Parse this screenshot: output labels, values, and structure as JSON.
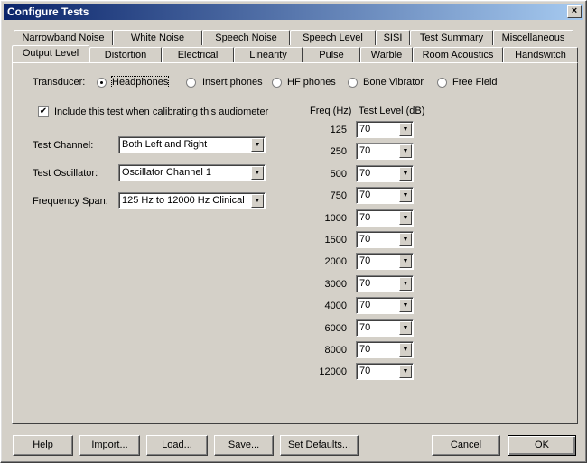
{
  "window": {
    "title": "Configure Tests",
    "close": "×"
  },
  "tabs_back": [
    "Narrowband Noise",
    "White Noise",
    "Speech Noise",
    "Speech Level",
    "SISI",
    "Test Summary",
    "Miscellaneous"
  ],
  "tabs_front": [
    "Output Level",
    "Distortion",
    "Electrical",
    "Linearity",
    "Pulse",
    "Warble",
    "Room Acoustics",
    "Handswitch"
  ],
  "active_tab": "Output Level",
  "transducer": {
    "label": "Transducer:",
    "options": [
      "Headphones",
      "Insert phones",
      "HF phones",
      "Bone Vibrator",
      "Free Field"
    ],
    "selected": "Headphones"
  },
  "include_calibration": {
    "label": "Include this test when calibrating this audiometer",
    "checked": true,
    "mark": "✔"
  },
  "fields": {
    "channel": {
      "label": "Test Channel:",
      "value": "Both Left and Right"
    },
    "oscillator": {
      "label": "Test Oscillator:",
      "value": "Oscillator Channel 1"
    },
    "span": {
      "label": "Frequency Span:",
      "value": "125 Hz to 12000 Hz Clinical"
    }
  },
  "freq_table": {
    "freq_header": "Freq (Hz)",
    "level_header": "Test Level (dB)",
    "rows": [
      {
        "freq": "125",
        "level": "70"
      },
      {
        "freq": "250",
        "level": "70"
      },
      {
        "freq": "500",
        "level": "70"
      },
      {
        "freq": "750",
        "level": "70"
      },
      {
        "freq": "1000",
        "level": "70"
      },
      {
        "freq": "1500",
        "level": "70"
      },
      {
        "freq": "2000",
        "level": "70"
      },
      {
        "freq": "3000",
        "level": "70"
      },
      {
        "freq": "4000",
        "level": "70"
      },
      {
        "freq": "6000",
        "level": "70"
      },
      {
        "freq": "8000",
        "level": "70"
      },
      {
        "freq": "12000",
        "level": "70"
      }
    ]
  },
  "buttons": {
    "help": "Help",
    "import": "Import...",
    "load": "Load...",
    "save": "Save...",
    "defaults": "Set Defaults...",
    "cancel": "Cancel",
    "ok": "OK"
  },
  "icons": {
    "dropdown": "▼"
  }
}
